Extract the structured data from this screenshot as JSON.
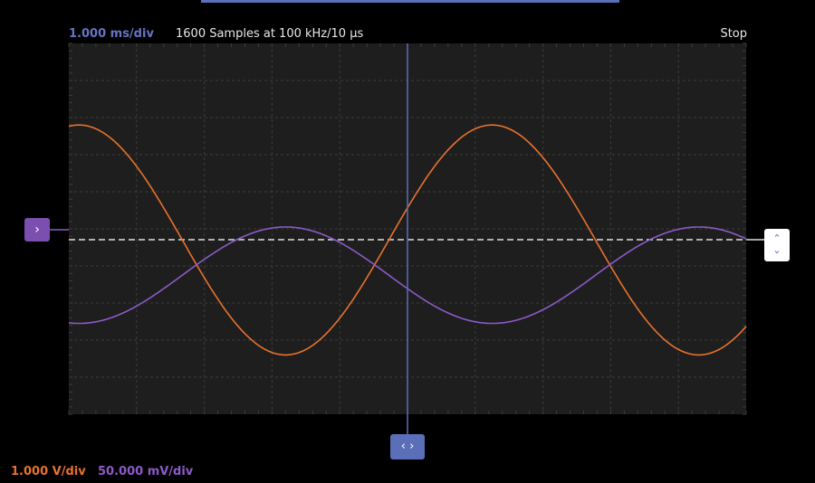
{
  "header": {
    "timebase": "1.000 ms/div",
    "samples": "1600 Samples at 100 kHz/10 µs",
    "run_state": "Stop"
  },
  "footer": {
    "ch1_scale": "1.000 V/div",
    "ch2_scale": "50.000 mV/div"
  },
  "controls": {
    "channel_marker_glyph": "›",
    "trigger_up_glyph": "⌃",
    "trigger_down_glyph": "⌄",
    "cursor_handle_glyph": "‹ ›"
  },
  "colors": {
    "background": "#000000",
    "grid_background": "#1e1e1e",
    "grid_line": "#3c3c3c",
    "ch1": "#e8722c",
    "ch2": "#8d5ac8",
    "cursor": "#5a6fb8",
    "trigger_level": "#e0e0e0"
  },
  "icons": {
    "channel_marker": "chevron-right-icon",
    "trigger_up": "chevron-up-icon",
    "trigger_down": "chevron-down-icon",
    "cursor_handle": "left-right-arrows-icon"
  },
  "chart_data": {
    "type": "line",
    "title": "",
    "xlabel": "",
    "ylabel": "",
    "x_divisions": 10,
    "y_divisions": 10,
    "grid": true,
    "series": [
      {
        "channel": 1,
        "color": "#e8722c",
        "shape": "cosine",
        "amplitude_div": 3.1,
        "offset_div": -0.3,
        "period_div": 6.1,
        "phase_div": 0.15
      },
      {
        "channel": 2,
        "color": "#8d5ac8",
        "shape": "cosine",
        "amplitude_div": 1.3,
        "offset_div": -1.25,
        "period_div": 6.1,
        "phase_div": 3.2
      }
    ],
    "trigger_level_div": 0,
    "cursor_time_div": 5.0
  }
}
